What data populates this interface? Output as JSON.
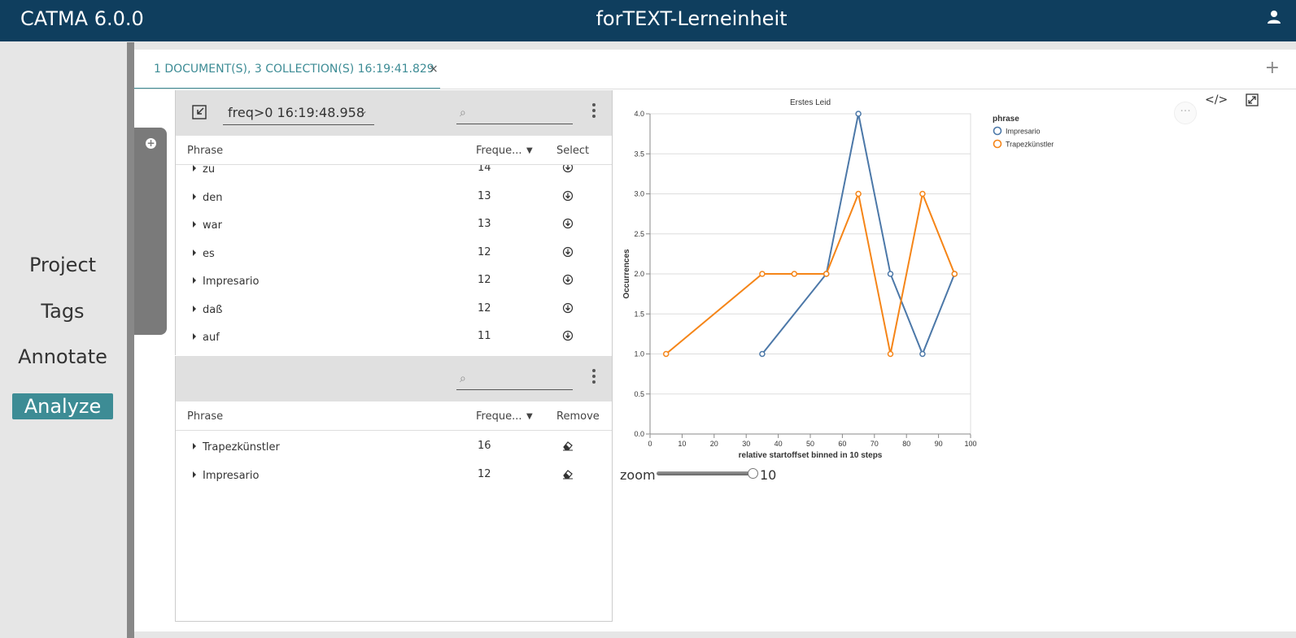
{
  "header": {
    "app_title": "CATMA 6.0.0",
    "project_title": "forTEXT-Lerneinheit",
    "user_icon": "user-icon"
  },
  "nav": {
    "items": [
      {
        "label": "Project"
      },
      {
        "label": "Tags"
      },
      {
        "label": "Annotate"
      },
      {
        "label": "Analyze",
        "active": true
      }
    ]
  },
  "tab": {
    "label": "1 DOCUMENT(S), 3 COLLECTION(S) 16:19:41.829",
    "close": "×",
    "add": "+"
  },
  "results_panel": {
    "query_value": "freq>0 16:19:48.958",
    "search_icon": "⌕",
    "columns": {
      "phrase": "Phrase",
      "frequency": "Freque...",
      "action": "Select"
    },
    "rows": [
      {
        "phrase": "zu",
        "freq": "14"
      },
      {
        "phrase": "den",
        "freq": "13"
      },
      {
        "phrase": "war",
        "freq": "13"
      },
      {
        "phrase": "es",
        "freq": "12"
      },
      {
        "phrase": "Impresario",
        "freq": "12"
      },
      {
        "phrase": "daß",
        "freq": "12"
      },
      {
        "phrase": "auf",
        "freq": "11"
      }
    ]
  },
  "selected_panel": {
    "search_icon": "⌕",
    "columns": {
      "phrase": "Phrase",
      "frequency": "Freque...",
      "action": "Remove"
    },
    "rows": [
      {
        "phrase": "Trapezkünstler",
        "freq": "16"
      },
      {
        "phrase": "Impresario",
        "freq": "12"
      }
    ]
  },
  "chart_toolbar": {
    "dots": "···",
    "code": "</>"
  },
  "zoom": {
    "label": "zoom",
    "value": "10",
    "level": 1.0
  },
  "chart_data": {
    "type": "line",
    "title": "Erstes Leid",
    "xlabel": "relative startoffset binned in 10 steps",
    "ylabel": "Occurrences",
    "xlim": [
      0,
      100
    ],
    "ylim": [
      0,
      4
    ],
    "xticks": [
      "0",
      "10",
      "20",
      "30",
      "40",
      "50",
      "60",
      "70",
      "80",
      "90",
      "100"
    ],
    "yticks": [
      "0.0",
      "0.5",
      "1.0",
      "1.5",
      "2.0",
      "2.5",
      "3.0",
      "3.5",
      "4.0"
    ],
    "grid": true,
    "legend_title": "phrase",
    "legend_position": "right",
    "series": [
      {
        "name": "Impresario",
        "color": "#4c78a8",
        "x": [
          35,
          55,
          65,
          75,
          85,
          95
        ],
        "y": [
          1,
          2,
          4,
          2,
          1,
          2
        ]
      },
      {
        "name": "Trapezkünstler",
        "color": "#f58518",
        "x": [
          5,
          35,
          45,
          55,
          65,
          75,
          85,
          95
        ],
        "y": [
          1,
          2,
          2,
          2,
          3,
          1,
          3,
          2
        ]
      }
    ]
  }
}
